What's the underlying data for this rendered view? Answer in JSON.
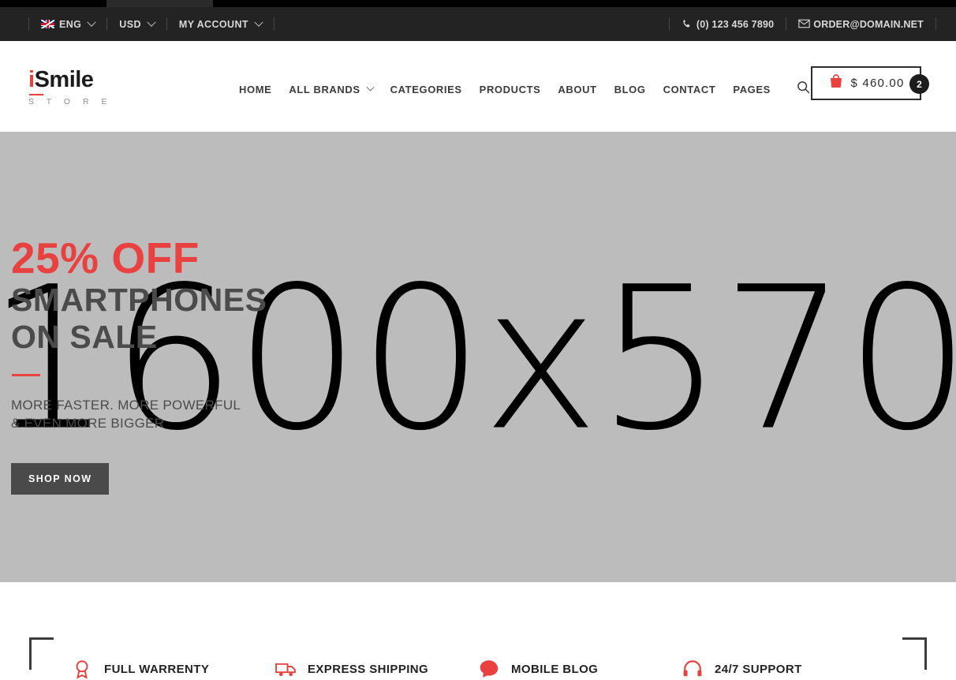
{
  "browser": {
    "tab_ghost": ""
  },
  "topbar": {
    "language": {
      "label": "ENG",
      "icon": "uk-flag-icon",
      "chevron": "chevron-down-icon"
    },
    "currency": {
      "label": "USD",
      "chevron": "chevron-down-icon"
    },
    "account": {
      "label": "MY ACCOUNT",
      "chevron": "chevron-down-icon"
    },
    "phone": {
      "label": "(0) 123 456 7890",
      "icon": "phone-icon"
    },
    "email": {
      "label": "ORDER@DOMAIN.NET",
      "icon": "mail-icon"
    }
  },
  "header": {
    "logo": {
      "accent_letter": "i",
      "rest": "Smile",
      "subtitle": "S T O R E"
    },
    "nav": [
      {
        "label": "HOME",
        "has_dropdown": false
      },
      {
        "label": "ALL BRANDS",
        "has_dropdown": true
      },
      {
        "label": "CATEGORIES",
        "has_dropdown": false
      },
      {
        "label": "PRODUCTS",
        "has_dropdown": false
      },
      {
        "label": "ABOUT",
        "has_dropdown": false
      },
      {
        "label": "BLOG",
        "has_dropdown": false
      },
      {
        "label": "CONTACT",
        "has_dropdown": false
      },
      {
        "label": "PAGES",
        "has_dropdown": false
      }
    ],
    "search_icon": "search-icon",
    "cart": {
      "icon": "shopping-bag-icon",
      "price": "$ 460.00",
      "count": "2"
    }
  },
  "hero": {
    "watermark": "1600x570",
    "offer": "25% OFF",
    "headline_line1": "SMARTPHONES",
    "headline_line2": "ON SALE",
    "sub_line1": "MORE FASTER. MORE POWERFUL",
    "sub_line2": "& EVEN MORE BIGGER",
    "cta": "SHOP NOW"
  },
  "features": [
    {
      "title": "FULL WARRENTY",
      "icon": "award-icon"
    },
    {
      "title": "EXPRESS SHIPPING",
      "icon": "truck-icon"
    },
    {
      "title": "MOBILE BLOG",
      "icon": "chat-icon"
    },
    {
      "title": "24/7 SUPPORT",
      "icon": "headphones-icon"
    }
  ],
  "colors": {
    "accent_red": "#e8413f",
    "topbar_bg": "#232323",
    "hero_bg": "#bcbcbc",
    "text_dark": "#3b3b3b",
    "cta_bg": "#4a4a4a"
  }
}
